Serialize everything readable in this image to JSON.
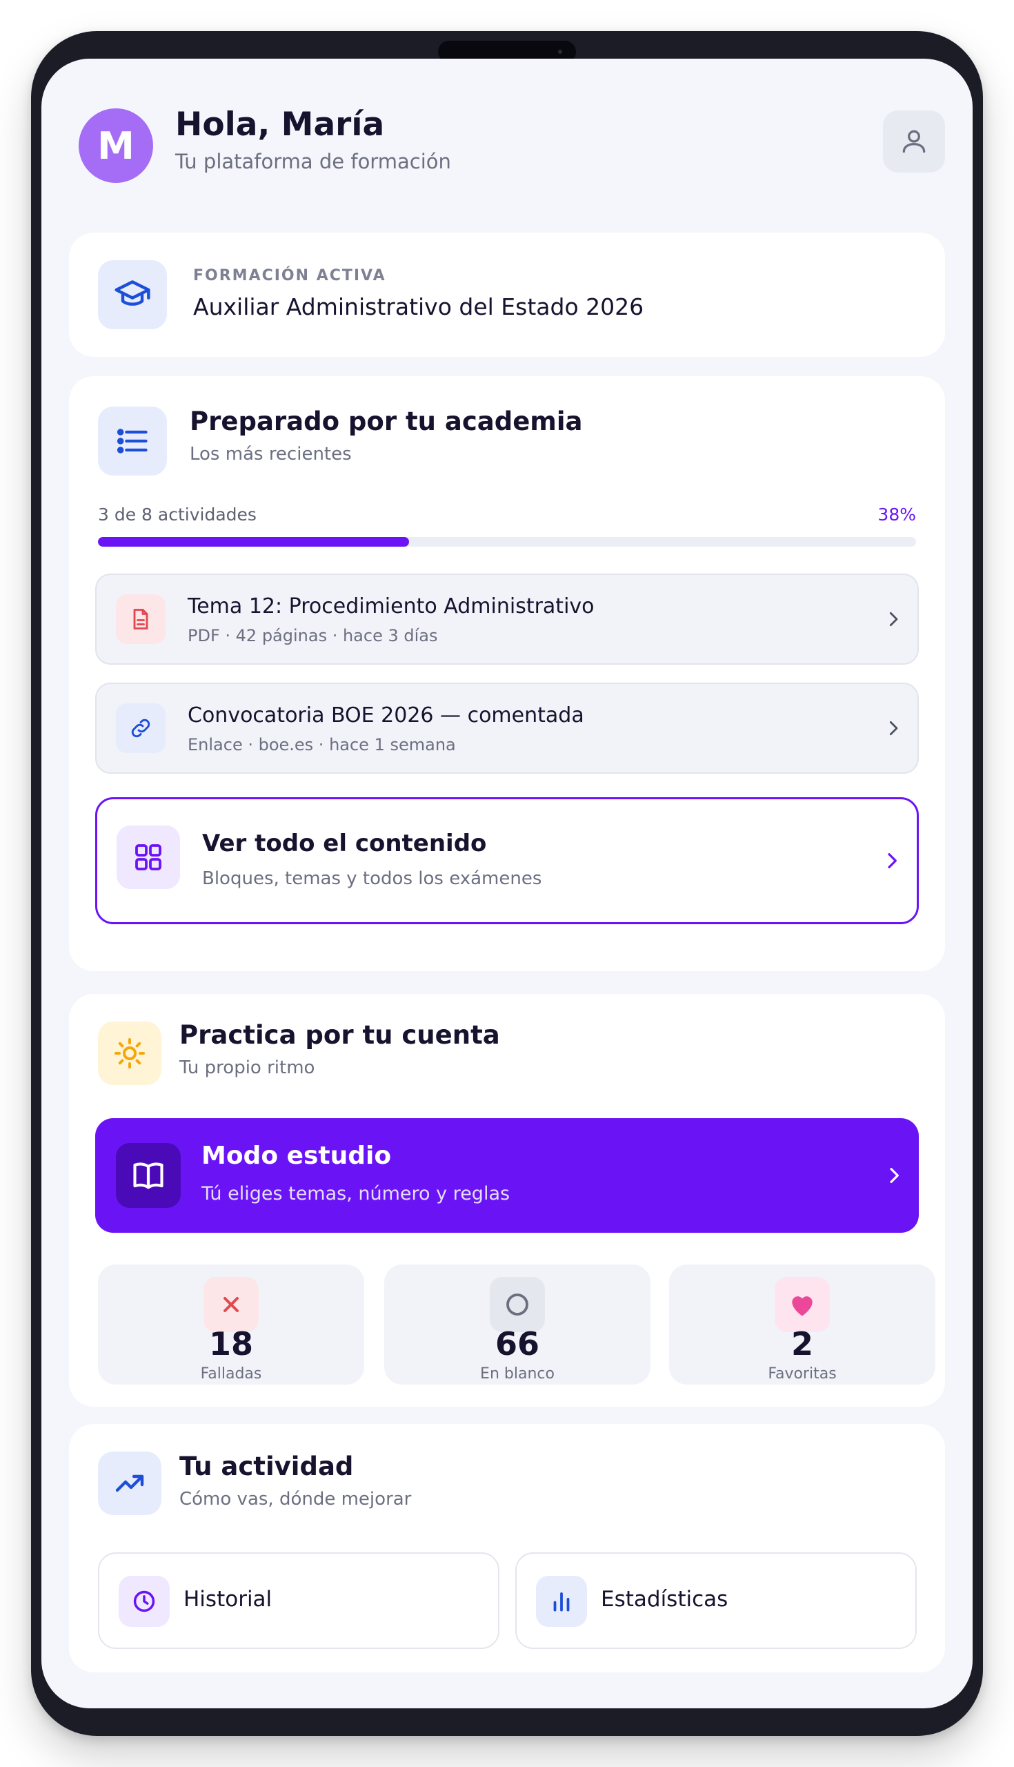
{
  "header": {
    "avatar_initial": "M",
    "greeting": "Hola, María",
    "subtitle": "Tu plataforma de formación"
  },
  "active_training": {
    "eyebrow": "FORMACIÓN ACTIVA",
    "title": "Auxiliar Administrativo del Estado 2026"
  },
  "academy": {
    "title": "Preparado por tu academia",
    "subtitle": "Los más recientes",
    "progress_label": "3 de 8 actividades",
    "progress_pct": "38%",
    "progress_value": 0.38,
    "items": [
      {
        "title": "Tema 12: Procedimiento Administrativo",
        "meta": "PDF · 42 páginas · hace 3 días",
        "icon": "document-icon"
      },
      {
        "title": "Convocatoria BOE 2026 — comentada",
        "meta": "Enlace · boe.es · hace 1 semana",
        "icon": "link-icon"
      }
    ],
    "see_all": {
      "title": "Ver todo el contenido",
      "subtitle": "Bloques, temas y todos los exámenes"
    }
  },
  "practice": {
    "title": "Practica por tu cuenta",
    "subtitle": "Tu propio ritmo",
    "study_mode": {
      "title": "Modo estudio",
      "subtitle": "Tú eliges temas, número y reglas"
    },
    "stats": [
      {
        "value": "18",
        "label": "Falladas",
        "icon": "cross-icon",
        "color": "#e2474f"
      },
      {
        "value": "66",
        "label": "En blanco",
        "icon": "circle-icon",
        "color": "#6b6f80"
      },
      {
        "value": "2",
        "label": "Favoritas",
        "icon": "heart-icon",
        "color": "#ec4899"
      }
    ]
  },
  "activity": {
    "title": "Tu actividad",
    "subtitle": "Cómo vas, dónde mejorar",
    "buttons": [
      {
        "label": "Historial",
        "icon": "clock-icon"
      },
      {
        "label": "Estadísticas",
        "icon": "bar-chart-icon"
      }
    ]
  },
  "colors": {
    "accent": "#6a14f5",
    "text": "#17122e",
    "muted": "#6b6f80",
    "avatar": "#a56cf5",
    "background": "#f5f6fb"
  }
}
